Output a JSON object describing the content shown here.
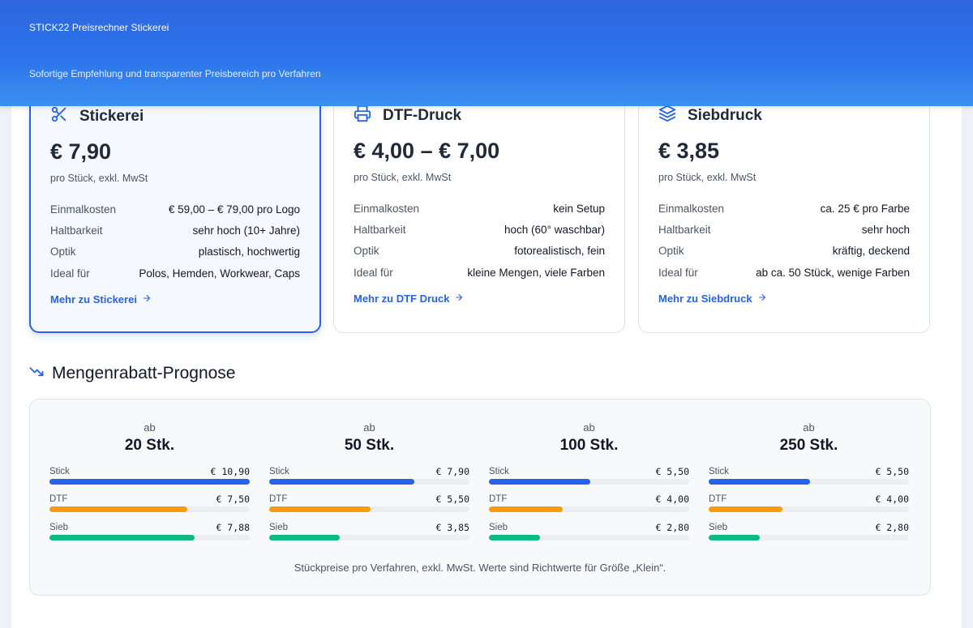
{
  "header": {
    "title": "STICK22 Preisrechner Stickerei",
    "subtitle": "Sofortige Empfehlung und transparenter Preisbereich pro Verfahren"
  },
  "cards": [
    {
      "name": "Stickerei",
      "icon": "scissors-icon",
      "price": "€ 7,90",
      "price_note": "pro Stück, exkl. MwSt",
      "rows": [
        {
          "k": "Einmalkosten",
          "v": "€ 59,00 – € 79,00 pro Logo"
        },
        {
          "k": "Haltbarkeit",
          "v": "sehr hoch (10+ Jahre)"
        },
        {
          "k": "Optik",
          "v": "plastisch, hochwertig"
        },
        {
          "k": "Ideal für",
          "v": "Polos, Hemden, Workwear, Caps"
        }
      ],
      "more": "Mehr zu Stickerei",
      "selected": true
    },
    {
      "name": "DTF-Druck",
      "icon": "printer-icon",
      "price": "€ 4,00 – € 7,00",
      "price_note": "pro Stück, exkl. MwSt",
      "rows": [
        {
          "k": "Einmalkosten",
          "v": "kein Setup"
        },
        {
          "k": "Haltbarkeit",
          "v": "hoch (60° waschbar)"
        },
        {
          "k": "Optik",
          "v": "fotorealistisch, fein"
        },
        {
          "k": "Ideal für",
          "v": "kleine Mengen, viele Farben"
        }
      ],
      "more": "Mehr zu DTF Druck",
      "selected": false
    },
    {
      "name": "Siebdruck",
      "icon": "layers-icon",
      "price": "€ 3,85",
      "price_note": "pro Stück, exkl. MwSt",
      "rows": [
        {
          "k": "Einmalkosten",
          "v": "ca. 25 € pro Farbe"
        },
        {
          "k": "Haltbarkeit",
          "v": "sehr hoch"
        },
        {
          "k": "Optik",
          "v": "kräftig, deckend"
        },
        {
          "k": "Ideal für",
          "v": "ab ca. 50 Stück, wenige Farben"
        }
      ],
      "more": "Mehr zu Siebdruck",
      "selected": false
    }
  ],
  "discount": {
    "title": "Mengenrabatt-Prognose",
    "icon": "trend-down-icon",
    "colors": {
      "Stick": "#2563eb",
      "DTF": "#f59e0b",
      "Sieb": "#10b981"
    },
    "max_value": 10.9,
    "tiers": [
      {
        "ab": "ab",
        "qty": "20 Stk.",
        "methods": [
          {
            "label": "Stick",
            "value": 10.9,
            "display": "€ 10,90"
          },
          {
            "label": "DTF",
            "value": 7.5,
            "display": "€ 7,50"
          },
          {
            "label": "Sieb",
            "value": 7.88,
            "display": "€ 7,88"
          }
        ]
      },
      {
        "ab": "ab",
        "qty": "50 Stk.",
        "methods": [
          {
            "label": "Stick",
            "value": 7.9,
            "display": "€ 7,90"
          },
          {
            "label": "DTF",
            "value": 5.5,
            "display": "€ 5,50"
          },
          {
            "label": "Sieb",
            "value": 3.85,
            "display": "€ 3,85"
          }
        ]
      },
      {
        "ab": "ab",
        "qty": "100 Stk.",
        "methods": [
          {
            "label": "Stick",
            "value": 5.5,
            "display": "€ 5,50"
          },
          {
            "label": "DTF",
            "value": 4.0,
            "display": "€ 4,00"
          },
          {
            "label": "Sieb",
            "value": 2.8,
            "display": "€ 2,80"
          }
        ]
      },
      {
        "ab": "ab",
        "qty": "250 Stk.",
        "methods": [
          {
            "label": "Stick",
            "value": 5.5,
            "display": "€ 5,50"
          },
          {
            "label": "DTF",
            "value": 4.0,
            "display": "€ 4,00"
          },
          {
            "label": "Sieb",
            "value": 2.8,
            "display": "€ 2,80"
          }
        ]
      }
    ],
    "footnote": "Stückpreise pro Verfahren, exkl. MwSt. Werte sind Richtwerte für Größe „Klein“."
  }
}
